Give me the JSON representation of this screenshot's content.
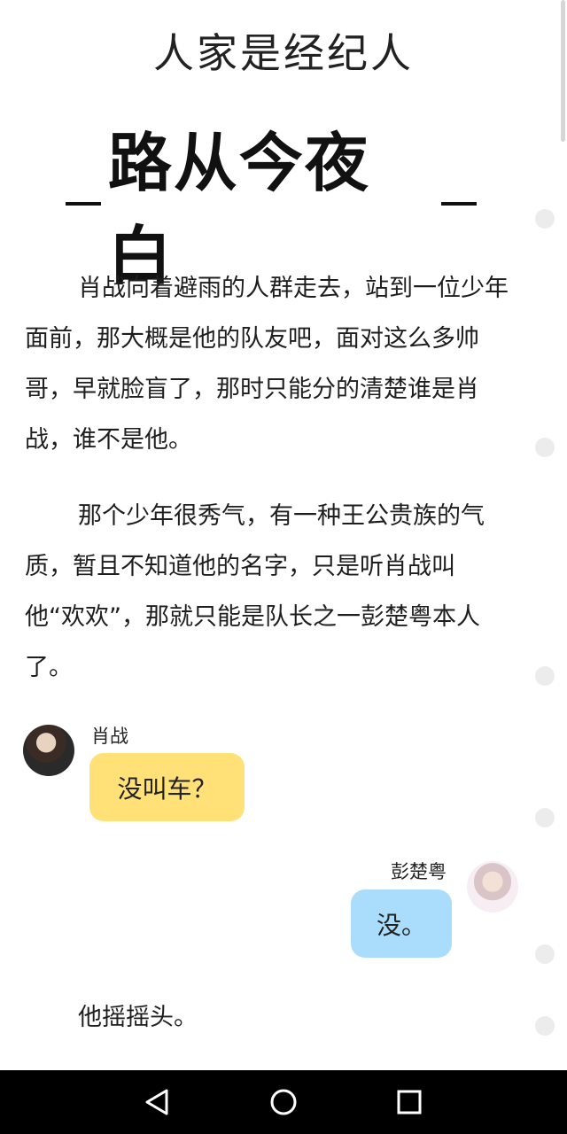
{
  "page": {
    "title": "人家是经纪人",
    "chapter_title": "路从今夜白"
  },
  "story": {
    "paragraph_1": "肖战向着避雨的人群走去，站到一位少年面前，那大概是他的队友吧，面对这么多帅哥，早就脸盲了，那时只能分的清楚谁是肖战，谁不是他。",
    "paragraph_2": "那个少年很秀气，有一种王公贵族的气质，暂且不知道他的名字，只是听肖战叫他“欢欢”，那就只能是队长之一彭楚粤本人了。",
    "paragraph_3": "他摇摇头。"
  },
  "chat": [
    {
      "speaker": "肖战",
      "message": "没叫车？",
      "side": "left",
      "bubble_color": "#ffe177"
    },
    {
      "speaker": "彭楚粤",
      "message": "没。",
      "side": "right",
      "bubble_color": "#a9ddfb"
    }
  ],
  "navbar": {
    "back_icon": "triangle-back-icon",
    "home_icon": "circle-home-icon",
    "recent_icon": "square-recent-icon"
  }
}
